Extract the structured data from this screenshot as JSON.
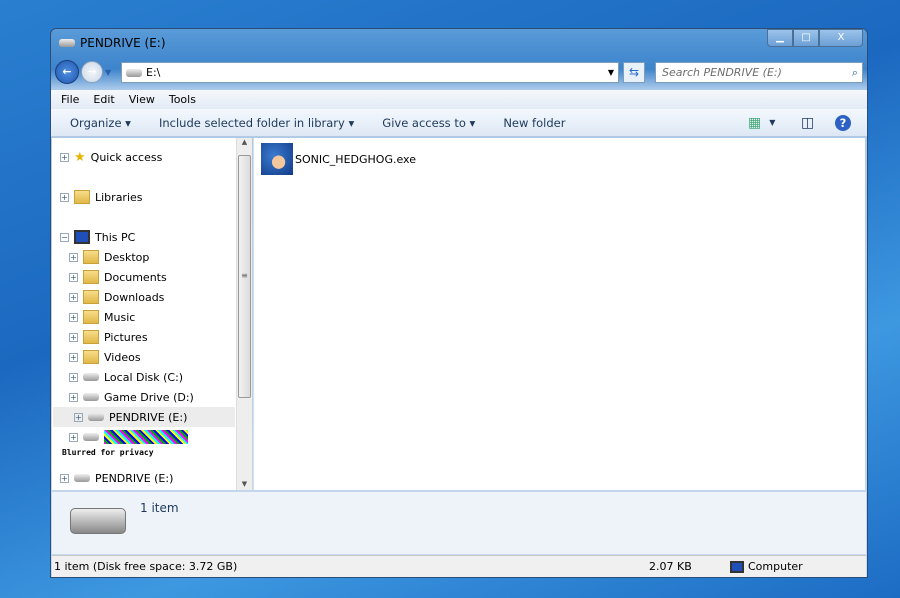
{
  "window": {
    "title": "PENDRIVE (E:)",
    "minimize": "▁",
    "maximize": "□",
    "close": "X"
  },
  "address": {
    "path": "E:\\",
    "search_placeholder": "Search PENDRIVE (E:)"
  },
  "menu": [
    "File",
    "Edit",
    "View",
    "Tools"
  ],
  "commands": {
    "organize": "Organize ▾",
    "include": "Include selected folder in library ▾",
    "give_access": "Give access to ▾",
    "new_folder": "New folder"
  },
  "nav": {
    "quick_access": "Quick access",
    "libraries": "Libraries",
    "this_pc": "This PC",
    "items": [
      "Desktop",
      "Documents",
      "Downloads",
      "Music",
      "Pictures",
      "Videos",
      "Local Disk (C:)",
      "Game Drive (D:)",
      "PENDRIVE (E:)"
    ],
    "privacy_note": "Blurred for privacy",
    "pendrive": "PENDRIVE (E:)"
  },
  "files": [
    {
      "name": "SONIC_HEDGHOG.exe",
      "icon": "sonic-icon"
    }
  ],
  "details": {
    "count": "1 item"
  },
  "status": {
    "left": "1 item (Disk free space: 3.72 GB)",
    "size": "2.07 KB",
    "location": "Computer"
  }
}
